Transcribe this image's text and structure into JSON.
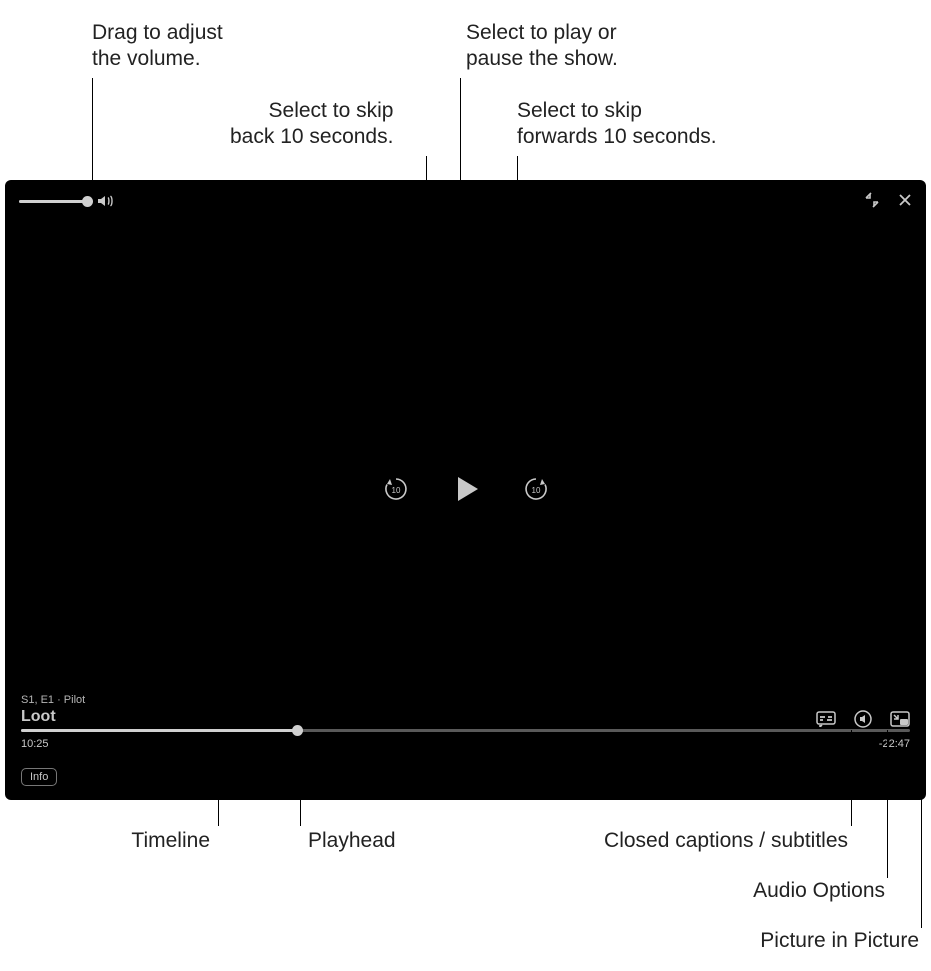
{
  "callouts": {
    "volume": "Drag to adjust\nthe volume.",
    "back10": "Select to skip\nback 10 seconds.",
    "playpause": "Select to play or\npause the show.",
    "fwd10": "Select to skip\nforwards 10 seconds.",
    "timeline": "Timeline",
    "playhead": "Playhead",
    "cc": "Closed captions / subtitles",
    "audio": "Audio Options",
    "pip": "Picture in Picture"
  },
  "player": {
    "episode": "S1, E1 · Pilot",
    "title": "Loot",
    "elapsed": "10:25",
    "remaining": "-22:47",
    "info_label": "Info",
    "progress_pct": 31,
    "volume_pct": 95,
    "skip_seconds": "10"
  }
}
